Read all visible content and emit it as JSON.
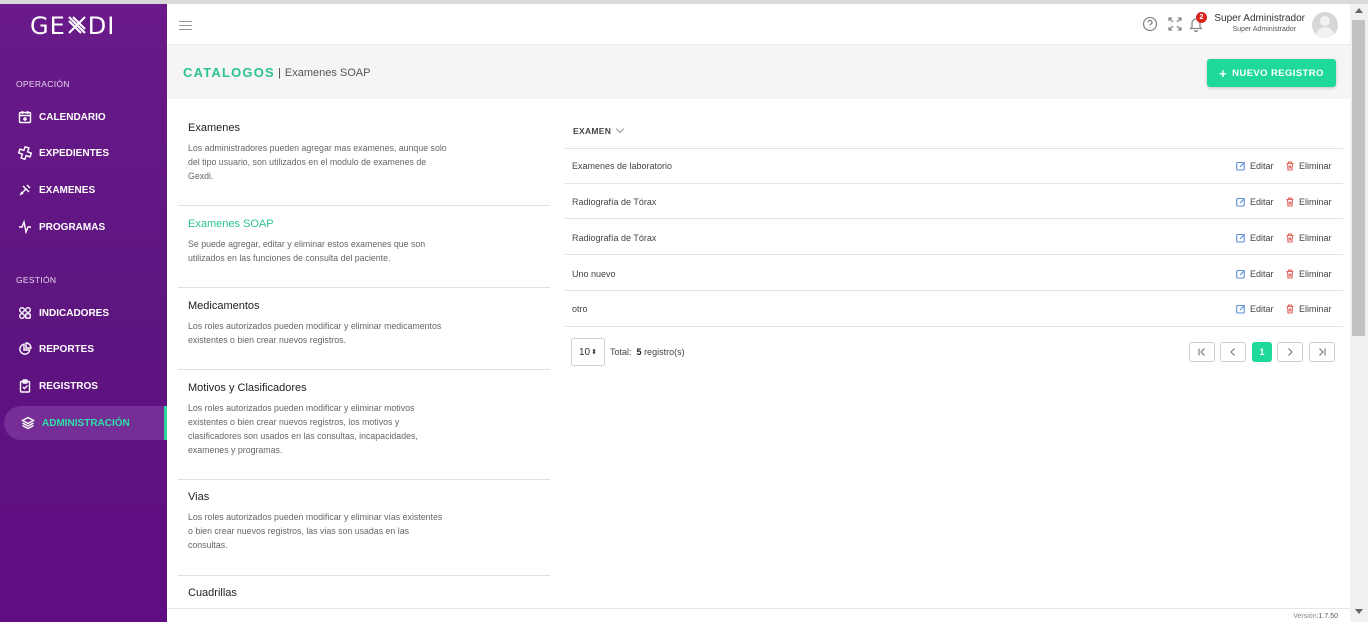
{
  "app": {
    "logo_left": "GE",
    "logo_right": "DI",
    "version_label": "Versión:",
    "version_value": "1.7.50"
  },
  "sidebar": {
    "sections": [
      {
        "label": "OPERACIÓN"
      },
      {
        "label": "GESTIÓN"
      }
    ],
    "items": [
      {
        "label": "CALENDARIO",
        "icon": "calendar-icon"
      },
      {
        "label": "EXPEDIENTES",
        "icon": "medical-icon"
      },
      {
        "label": "EXAMENES",
        "icon": "syringe-icon"
      },
      {
        "label": "PROGRAMAS",
        "icon": "pulse-icon"
      },
      {
        "label": "INDICADORES",
        "icon": "grid-icon"
      },
      {
        "label": "REPORTES",
        "icon": "pie-chart-icon"
      },
      {
        "label": "REGISTROS",
        "icon": "clipboard-icon"
      },
      {
        "label": "ADMINISTRACIÓN",
        "icon": "layers-icon",
        "active": true
      }
    ]
  },
  "header": {
    "notification_count": "2",
    "user_name": "Super Administrador",
    "user_role": "Super Administrador"
  },
  "titlebar": {
    "title": "CATALOGOS",
    "breadcrumb": "Examenes SOAP",
    "new_button": "NUEVO REGISTRO"
  },
  "catalogs": [
    {
      "title": "Examenes",
      "description": "Los administradores pueden agregar mas examenes, aunque solo del tipo usuario, son utilizados en el modulo de examenes de Gexdi."
    },
    {
      "title": "Examenes SOAP",
      "description": "Se puede agregar, editar y eliminar estos examenes que son utilizados en las funciones de consulta del paciente.",
      "active": true
    },
    {
      "title": "Medicamentos",
      "description": "Los roles autorizados pueden modificar y eliminar medicamentos existentes o bien crear nuevos registros."
    },
    {
      "title": "Motivos y Clasificadores",
      "description": "Los roles autorizados pueden modificar y eliminar motivos existentes o bien crear nuevos registros, los motivos y clasificadores son usados en las consultas, incapacidades, examenes y programas."
    },
    {
      "title": "Vias",
      "description": "Los roles autorizados pueden modificar y eliminar vías existentes o bien crear nuevos registros, las vias son usadas en las consultas."
    },
    {
      "title": "Cuadrillas",
      "description": ""
    }
  ],
  "table": {
    "column_header": "EXAMEN",
    "edit_label": "Editar",
    "delete_label": "Eliminar",
    "rows": [
      {
        "name": "Examenes de laboratorio"
      },
      {
        "name": "Radiografía de Tórax"
      },
      {
        "name": "Radiografía de Tórax"
      },
      {
        "name": "Uno nuevo"
      },
      {
        "name": "otro"
      }
    ],
    "page_size": "10",
    "total_label": "Total:",
    "total_count": "5",
    "total_suffix": "registro(s)",
    "current_page": "1"
  },
  "colors": {
    "sidebar": "#5e1580",
    "accent": "#1fd99a",
    "title": "#2cc38f"
  }
}
